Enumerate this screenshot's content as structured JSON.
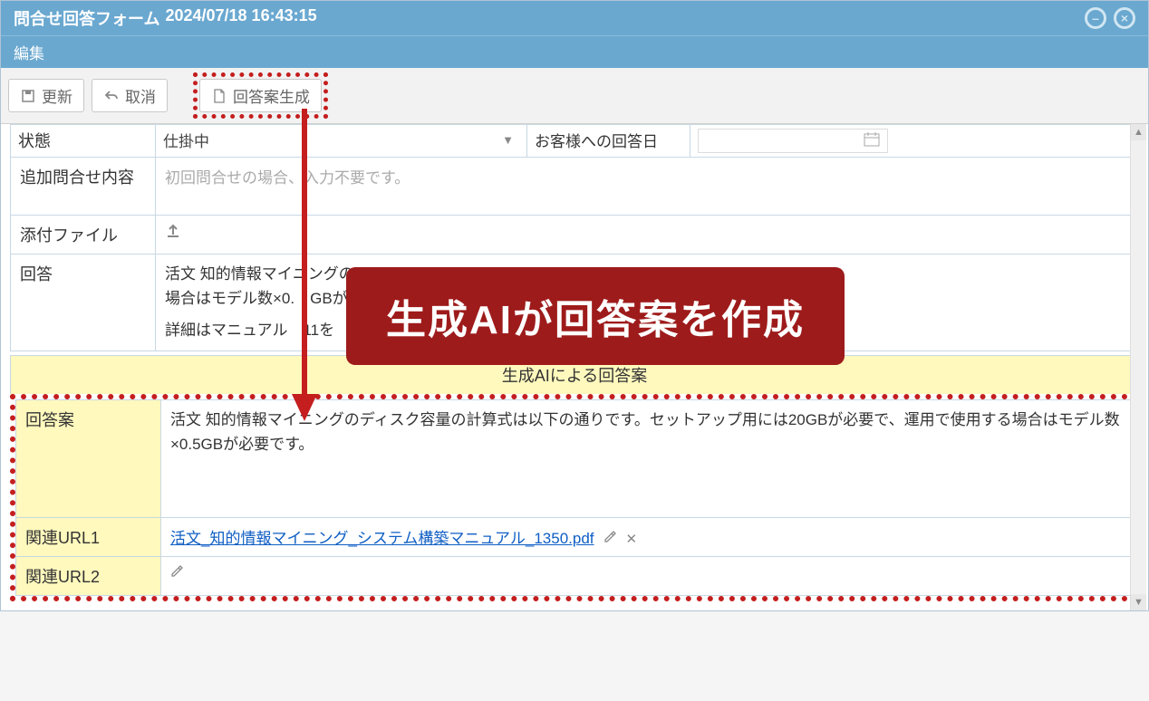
{
  "header": {
    "form_title": "問合せ回答フォーム",
    "timestamp": "2024/07/18 16:43:15",
    "menu_edit": "編集"
  },
  "toolbar": {
    "update": "更新",
    "cancel": "取消",
    "generate": "回答案生成"
  },
  "fields": {
    "status_label": "状態",
    "status_value": "仕掛中",
    "reply_date_label": "お客様への回答日",
    "additional_label": "追加問合せ内容",
    "additional_placeholder": "初回問合せの場合、入力不要です。",
    "attachment_label": "添付ファイル",
    "answer_label": "回答",
    "answer_value_line1": "活文 知的情報マイニングの",
    "answer_value_line2": "場合はモデル数×0.　GBが",
    "answer_value_line3": "詳細はマニュアル　11を",
    "ai_section_title": "生成AIによる回答案",
    "ai_answer_label": "回答案",
    "ai_answer_value": "活文 知的情報マイニングのディスク容量の計算式は以下の通りです。セットアップ用には20GBが必要で、運用で使用する場合はモデル数×0.5GBが必要です。",
    "url1_label": "関連URL1",
    "url1_link": "活文_知的情報マイニング_システム構築マニュアル_1350.pdf",
    "url2_label": "関連URL2"
  },
  "callout": {
    "text": "生成AIが回答案を作成"
  }
}
